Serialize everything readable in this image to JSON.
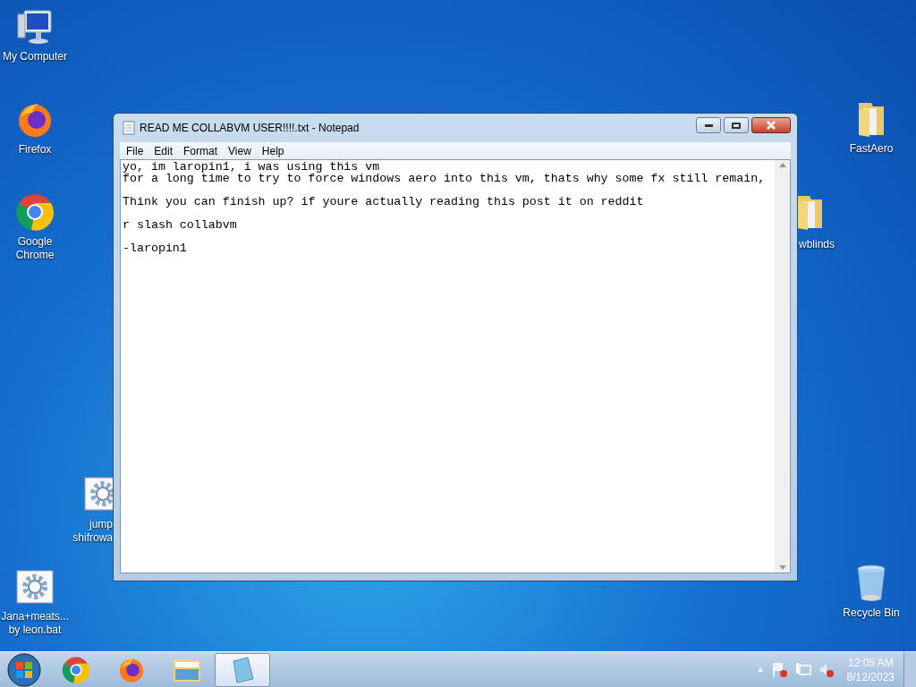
{
  "desktop_icons": [
    {
      "kind": "computer",
      "label_lines": [
        "My Computer"
      ]
    },
    {
      "kind": "firefox",
      "label_lines": [
        "Firefox"
      ]
    },
    {
      "kind": "chrome",
      "label_lines": [
        "Google",
        "Chrome"
      ]
    },
    {
      "kind": "gear",
      "label_lines": [
        "jump",
        "shifrowa"
      ]
    },
    {
      "kind": "gear",
      "label_lines": [
        "Jana+meats...",
        "by leon.bat"
      ]
    },
    {
      "kind": "folder",
      "label_lines": [
        "FastAero"
      ]
    },
    {
      "kind": "folder",
      "label_lines": [
        "wblinds"
      ]
    },
    {
      "kind": "recycle",
      "label_lines": [
        "Recycle Bin"
      ]
    }
  ],
  "window": {
    "title": "READ ME COLLABVM USER!!!!.txt - Notepad",
    "menu": [
      "File",
      "Edit",
      "Format",
      "View",
      "Help"
    ],
    "paragraphs": [
      [
        "yo, im laropin1, i was using this vm",
        "for a long time to try to force windows aero into this vm, thats why some fx still remain,"
      ],
      [
        "Think you can finish up? if youre actually reading this post it on reddit"
      ],
      [
        "r slash collabvm"
      ],
      [
        "-laropin1"
      ]
    ]
  },
  "taskbar": {
    "items": [
      {
        "kind": "start",
        "selected": false
      },
      {
        "kind": "chrome",
        "selected": false
      },
      {
        "kind": "firefox",
        "selected": false
      },
      {
        "kind": "explorer",
        "selected": false
      },
      {
        "kind": "notepad",
        "selected": true
      }
    ],
    "tray": [
      {
        "kind": "arrow",
        "text": "▲"
      },
      {
        "kind": "flag"
      },
      {
        "kind": "network"
      },
      {
        "kind": "speaker"
      }
    ],
    "time": "12:05 AM",
    "date": "8/12/2023"
  }
}
